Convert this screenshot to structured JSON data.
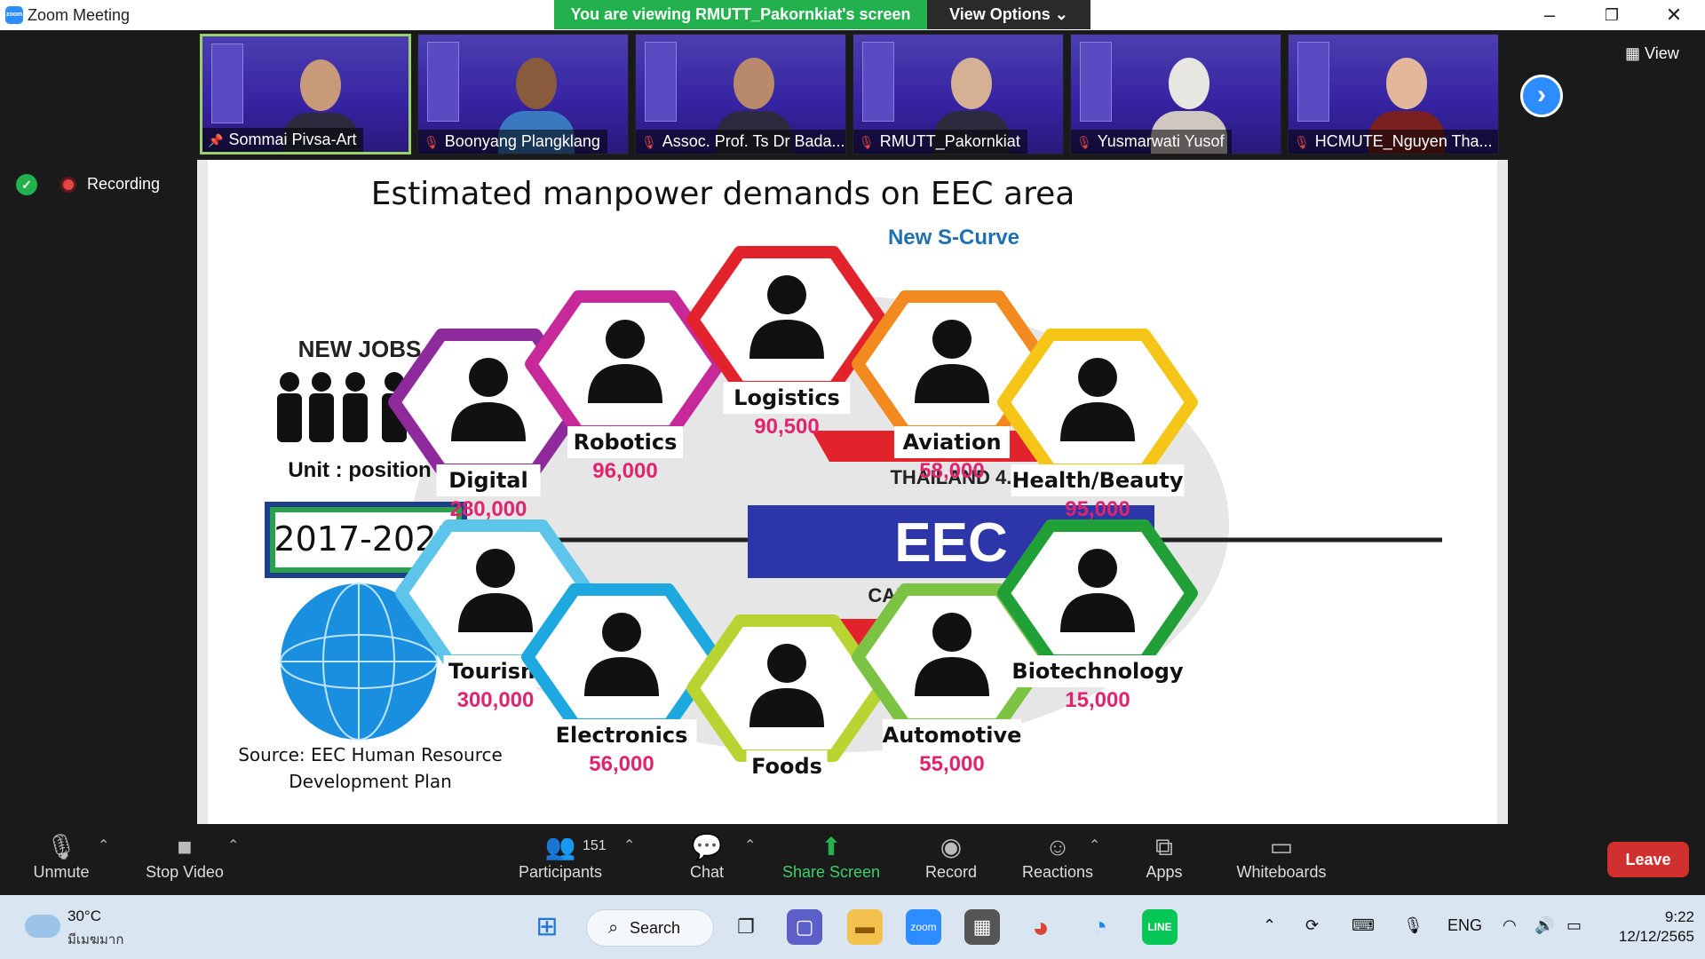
{
  "window": {
    "title": "Zoom Meeting",
    "logo_text": "zoom"
  },
  "banner": {
    "viewing": "You are viewing RMUTT_Pakornkiat's screen",
    "view_options": "View Options ⌄"
  },
  "window_controls": {
    "minimize": "–",
    "restore": "❐",
    "close": "✕"
  },
  "participants": [
    {
      "name": "Sommai Pivsa-Art",
      "muted": false,
      "pinned": true,
      "active": true
    },
    {
      "name": "Boonyang Plangklang",
      "muted": true
    },
    {
      "name": "Assoc. Prof. Ts Dr Bada...",
      "muted": true
    },
    {
      "name": "RMUTT_Pakornkiat",
      "muted": true
    },
    {
      "name": "Yusmarwati Yusof",
      "muted": true
    },
    {
      "name": "HCMUTE_Nguyen Tha...",
      "muted": true
    }
  ],
  "gallery": {
    "view_label": "View",
    "next_icon": "chevron-right-icon"
  },
  "recording": {
    "label": "Recording"
  },
  "slide": {
    "title": "Estimated manpower demands on EEC area",
    "subtitle": "New S-Curve",
    "new_jobs": "NEW JOBS",
    "unit": "Unit : position",
    "period": "2017-2023",
    "source_line1": "Source: EEC Human Resource",
    "source_line2": "Development Plan",
    "center_top": "THAILAND 4.0",
    "center": "EEC",
    "center_bottom": "CAREER GROWTH",
    "industries": [
      {
        "name": "Digital",
        "value": "280,000",
        "color": "#8e2a9c"
      },
      {
        "name": "Robotics",
        "value": "96,000",
        "color": "#c7299b"
      },
      {
        "name": "Logistics",
        "value": "90,500",
        "color": "#e3232b"
      },
      {
        "name": "Aviation",
        "value": "58,000",
        "color": "#f38a1f"
      },
      {
        "name": "Health/Beauty",
        "value": "95,000",
        "color": "#f5c518"
      },
      {
        "name": "Tourism",
        "value": "300,000",
        "color": "#5ec5ea"
      },
      {
        "name": "Electronics",
        "value": "56,000",
        "color": "#1ea8e0"
      },
      {
        "name": "Foods",
        "value": "",
        "color": "#b7d433"
      },
      {
        "name": "Automotive",
        "value": "55,000",
        "color": "#7cc243"
      },
      {
        "name": "Biotechnology",
        "value": "15,000",
        "color": "#22a038"
      }
    ],
    "value_color": "#e0246e"
  },
  "toolbar": {
    "unmute": "Unmute",
    "stop_video": "Stop Video",
    "participants": "Participants",
    "participant_count": "151",
    "chat": "Chat",
    "share_screen": "Share Screen",
    "record": "Record",
    "reactions": "Reactions",
    "apps": "Apps",
    "whiteboards": "Whiteboards",
    "leave": "Leave"
  },
  "taskbar": {
    "temperature": "30°C",
    "condition": "มีเมฆมาก",
    "search": "Search",
    "language": "ENG",
    "time": "9:22",
    "date": "12/12/2565"
  }
}
